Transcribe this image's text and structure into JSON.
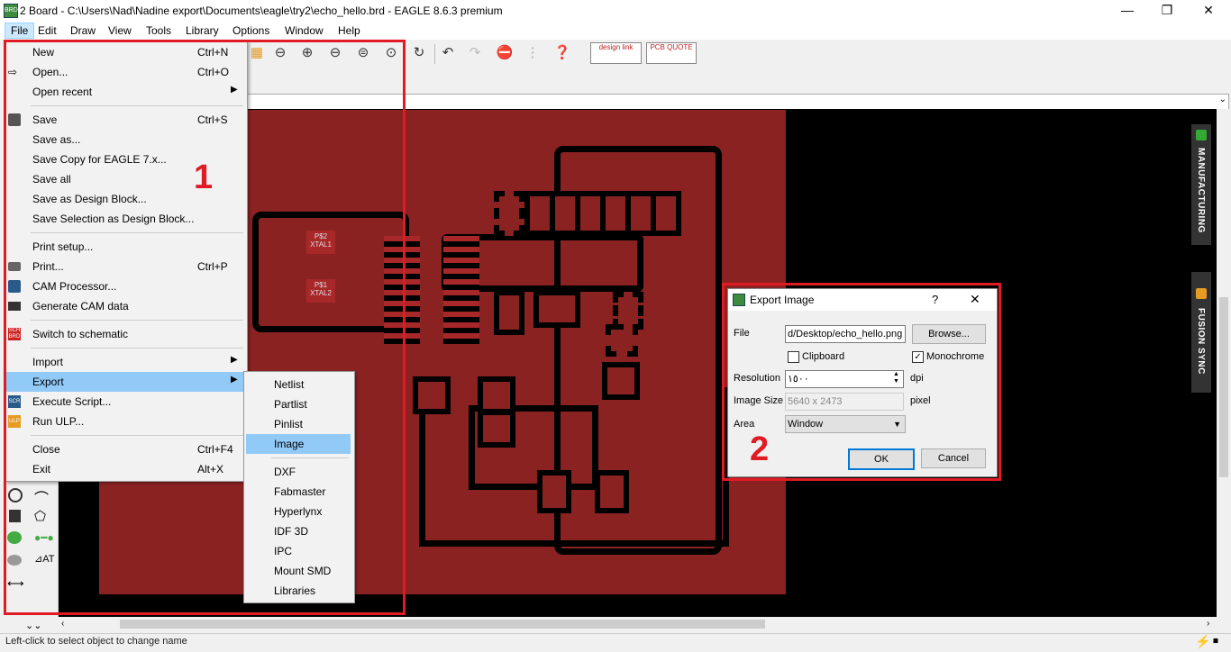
{
  "window": {
    "title": "2 Board - C:\\Users\\Nad\\Nadine export\\Documents\\eagle\\try2\\echo_hello.brd - EAGLE 8.6.3 premium",
    "minimize": "—",
    "restore": "❐",
    "close": "✕"
  },
  "menubar": [
    "File",
    "Edit",
    "Draw",
    "View",
    "Tools",
    "Library",
    "Options",
    "Window",
    "Help"
  ],
  "toolbar": {
    "designlink": "design link",
    "pcbquote": "PCB QUOTE"
  },
  "file_menu": {
    "items": [
      {
        "label": "New",
        "shortcut": "Ctrl+N"
      },
      {
        "label": "Open...",
        "shortcut": "Ctrl+O"
      },
      {
        "label": "Open recent",
        "shortcut": ""
      },
      {
        "label": "Save",
        "shortcut": "Ctrl+S"
      },
      {
        "label": "Save as...",
        "shortcut": ""
      },
      {
        "label": "Save Copy for EAGLE 7.x...",
        "shortcut": ""
      },
      {
        "label": "Save all",
        "shortcut": ""
      },
      {
        "label": "Save as Design Block...",
        "shortcut": ""
      },
      {
        "label": "Save Selection as Design Block...",
        "shortcut": ""
      },
      {
        "label": "Print setup...",
        "shortcut": ""
      },
      {
        "label": "Print...",
        "shortcut": "Ctrl+P"
      },
      {
        "label": "CAM Processor...",
        "shortcut": ""
      },
      {
        "label": "Generate CAM data",
        "shortcut": ""
      },
      {
        "label": "Switch to schematic",
        "shortcut": ""
      },
      {
        "label": "Import",
        "shortcut": ""
      },
      {
        "label": "Export",
        "shortcut": ""
      },
      {
        "label": "Execute Script...",
        "shortcut": ""
      },
      {
        "label": "Run ULP...",
        "shortcut": ""
      },
      {
        "label": "Close",
        "shortcut": "Ctrl+F4"
      },
      {
        "label": "Exit",
        "shortcut": "Alt+X"
      }
    ],
    "icon_labels": {
      "sch": "SCH BRD",
      "scr": "SCR",
      "ulp": "ULP"
    }
  },
  "export_submenu": [
    "Netlist",
    "Partlist",
    "Pinlist",
    "Image",
    "DXF",
    "Fabmaster",
    "Hyperlynx",
    "IDF 3D",
    "IPC",
    "Mount SMD",
    "Libraries"
  ],
  "board_labels": {
    "xtal1": "XTAL1",
    "xtal1_pin": "P$2",
    "xtal2": "XTAL2",
    "xtal2_pin": "P$1"
  },
  "side_panels": {
    "manufacturing": "MANUFACTURING",
    "fusion": "FUSION SYNC"
  },
  "dialog": {
    "title": "Export Image",
    "help": "?",
    "close": "✕",
    "file_label": "File",
    "file_value": "d/Desktop/echo_hello.png",
    "browse": "Browse...",
    "clipboard": "Clipboard",
    "monochrome": "Monochrome",
    "resolution_label": "Resolution",
    "resolution_value": "١٥٠٠",
    "dpi": "dpi",
    "image_size_label": "Image Size",
    "image_size_value": "5640 x 2473",
    "pixel": "pixel",
    "area_label": "Area",
    "area_value": "Window",
    "ok": "OK",
    "cancel": "Cancel"
  },
  "annotations": {
    "one": "1",
    "two": "2"
  },
  "status": {
    "text": "Left-click to select object to change name"
  },
  "colors": {
    "board": "#8b2222",
    "highlight": "#91c9f7",
    "annotation": "#e01b24"
  }
}
